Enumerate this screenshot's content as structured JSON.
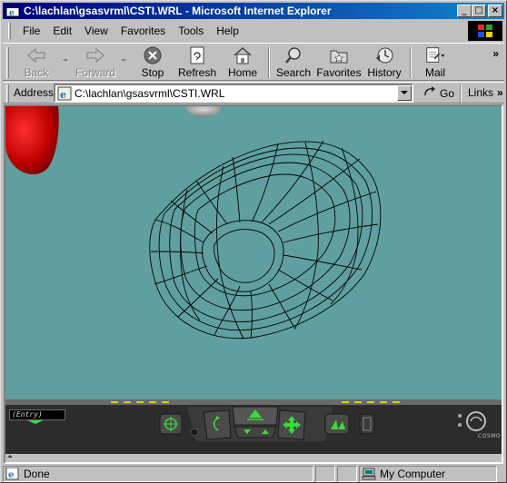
{
  "window": {
    "title": "C:\\lachlan\\gsasvrml\\CSTI.WRL - Microsoft Internet Explorer",
    "controls": {
      "minimize": "_",
      "maximize": "□",
      "close": "×"
    }
  },
  "menu": [
    {
      "label": "File"
    },
    {
      "label": "Edit"
    },
    {
      "label": "View"
    },
    {
      "label": "Favorites"
    },
    {
      "label": "Tools"
    },
    {
      "label": "Help"
    }
  ],
  "toolbar": {
    "back": "Back",
    "forward": "Forward",
    "stop": "Stop",
    "refresh": "Refresh",
    "home": "Home",
    "search": "Search",
    "favorites": "Favorites",
    "history": "History",
    "mail": "Mail",
    "overflow": "»"
  },
  "address": {
    "label": "Address",
    "value": "C:\\lachlan\\gsasvrml\\CSTI.WRL",
    "go": "Go",
    "links": "Links",
    "links_overflow": "»"
  },
  "dashboard": {
    "viewpoint": "(Entry)",
    "brand": "COSMO"
  },
  "status": {
    "text": "Done",
    "zone": "My Computer"
  },
  "colors": {
    "titlebar_start": "#000080",
    "titlebar_end": "#1084d0",
    "scene_background": "#5f9f9f",
    "dashboard_lights": "#d4d400",
    "nav_green": "#3cd83c"
  }
}
